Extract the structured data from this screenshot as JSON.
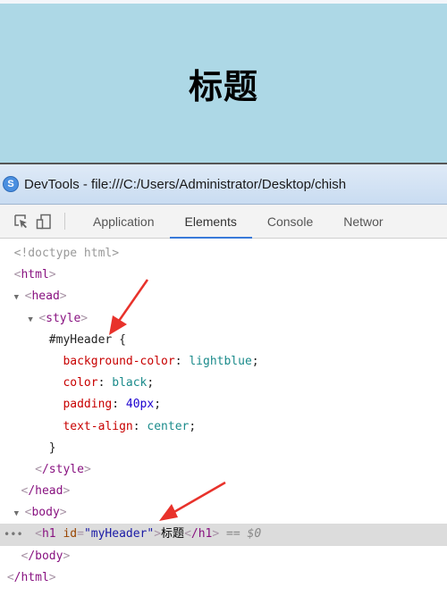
{
  "page": {
    "heading": "标题",
    "header_bg": "#add8e6"
  },
  "devtools": {
    "window_title": "DevTools - file:///C:/Users/Administrator/Desktop/chish",
    "tabs": [
      {
        "label": "Application",
        "active": false
      },
      {
        "label": "Elements",
        "active": true
      },
      {
        "label": "Console",
        "active": false
      },
      {
        "label": "Networ",
        "active": false
      }
    ],
    "icons": [
      "inspect-element-icon",
      "device-toolbar-icon"
    ]
  },
  "dom_tree": {
    "doctype": "<!doctype html>",
    "html_open": "html",
    "head": "head",
    "style": "style",
    "selector": "#myHeader {",
    "rules": [
      {
        "prop": "background-color",
        "value": "lightblue"
      },
      {
        "prop": "color",
        "value": "black"
      },
      {
        "prop": "padding",
        "value": "40px"
      },
      {
        "prop": "text-align",
        "value": "center"
      }
    ],
    "close_brace": "}",
    "style_close": "/style",
    "head_close": "/head",
    "body": "body",
    "h1_tag": "h1",
    "h1_attr_name": "id",
    "h1_attr_value": "\"myHeader\"",
    "h1_text": "标题",
    "h1_close": "/h1",
    "selected_marker": "== $0",
    "body_close": "/body",
    "html_close": "/html"
  },
  "annotations": {
    "arrow_color": "#e8322b"
  }
}
